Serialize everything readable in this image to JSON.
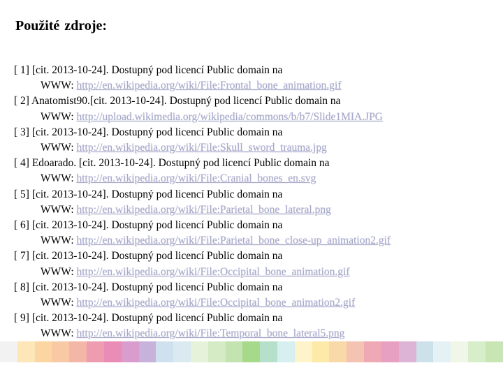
{
  "title": "Použité zdroje:",
  "references": [
    {
      "label": "[ 1] [cit. 2013-10-24]. Dostupný pod licencí Public domain na",
      "www": "WWW: ",
      "url": "http://en.wikipedia.org/wiki/File:Frontal_bone_animation.gif"
    },
    {
      "label": "[ 2] Anatomist90.[cit. 2013-10-24]. Dostupný pod licencí Public domain na",
      "www": "WWW: ",
      "url": "http://upload.wikimedia.org/wikipedia/commons/b/b7/Slide1MIA.JPG"
    },
    {
      "label": "[ 3]  [cit. 2013-10-24]. Dostupný pod licencí Public domain na",
      "www": "WWW: ",
      "url": "http://en.wikipedia.org/wiki/File:Skull_sword_trauma.jpg"
    },
    {
      "label": "[ 4]  Edoarado. [cit. 2013-10-24]. Dostupný pod licencí Public domain na",
      "www": "WWW: ",
      "url": "http://en.wikipedia.org/wiki/File:Cranial_bones_en.svg"
    },
    {
      "label": "[ 5] [cit. 2013-10-24]. Dostupný pod licencí Public domain na",
      "www": "WWW: ",
      "url": "http://en.wikipedia.org/wiki/File:Parietal_bone_lateral.png"
    },
    {
      "label": "[ 6] [cit. 2013-10-24]. Dostupný pod licencí Public domain na",
      "www": "WWW: ",
      "url": "http://en.wikipedia.org/wiki/File:Parietal_bone_close-up_animation2.gif"
    },
    {
      "label": "[ 7] [cit. 2013-10-24]. Dostupný pod licencí Public domain na",
      "www": "WWW: ",
      "url": "http://en.wikipedia.org/wiki/File:Occipital_bone_animation.gif"
    },
    {
      "label": "[ 8] [cit. 2013-10-24]. Dostupný pod licencí Public domain na",
      "www": "WWW: ",
      "url": "http://en.wikipedia.org/wiki/File:Occipital_bone_animation2.gif"
    },
    {
      "label": "[ 9] [cit. 2013-10-24]. Dostupný pod licencí Public domain na",
      "www": "WWW: ",
      "url": "http://en.wikipedia.org/wiki/File:Temporal_bone_lateral5.png"
    }
  ],
  "colors": {
    "link": "#a7a9c9",
    "stripe": [
      "#f2f2f2",
      "#fde7b8",
      "#fbd6a3",
      "#f9c9a6",
      "#f4b7a7",
      "#ee9db0",
      "#e98db7",
      "#d99ccc",
      "#c7b2dc",
      "#cfe0ee",
      "#dbe9f1",
      "#e6f2d9",
      "#d4ebc5",
      "#c3e3b0",
      "#a6d98a",
      "#b5e0c9",
      "#d7eff0",
      "#fff4c9",
      "#fdeaa8",
      "#f8d9a7",
      "#f4c3b1",
      "#eea8b6",
      "#e8a0c2",
      "#ddb3d6",
      "#cde1eb",
      "#e4f1f5",
      "#f0f7e8",
      "#d8edc9",
      "#c8e6b4"
    ]
  }
}
